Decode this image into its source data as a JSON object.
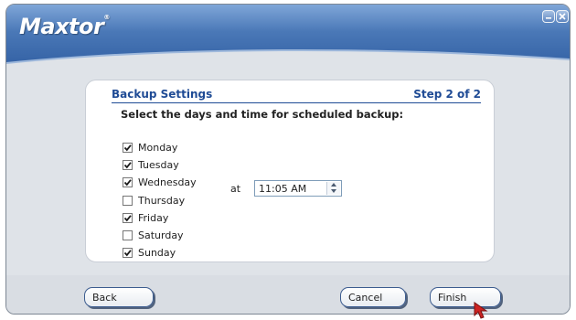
{
  "app": {
    "brand": "Maxtor",
    "brand_mark": "®"
  },
  "panel": {
    "title": "Backup Settings",
    "step": "Step 2 of 2",
    "instruction": "Select the days and time for scheduled backup:"
  },
  "days": [
    {
      "label": "Monday",
      "checked": true
    },
    {
      "label": "Tuesday",
      "checked": true
    },
    {
      "label": "Wednesday",
      "checked": true
    },
    {
      "label": "Thursday",
      "checked": false
    },
    {
      "label": "Friday",
      "checked": true
    },
    {
      "label": "Saturday",
      "checked": false
    },
    {
      "label": "Sunday",
      "checked": true
    }
  ],
  "schedule": {
    "at_label": "at",
    "time": "11:05 AM"
  },
  "buttons": {
    "back": "Back",
    "cancel": "Cancel",
    "finish": "Finish"
  },
  "colors": {
    "accent": "#1f4b95",
    "header": "#3a68ab",
    "cursor": "#cc2222"
  }
}
